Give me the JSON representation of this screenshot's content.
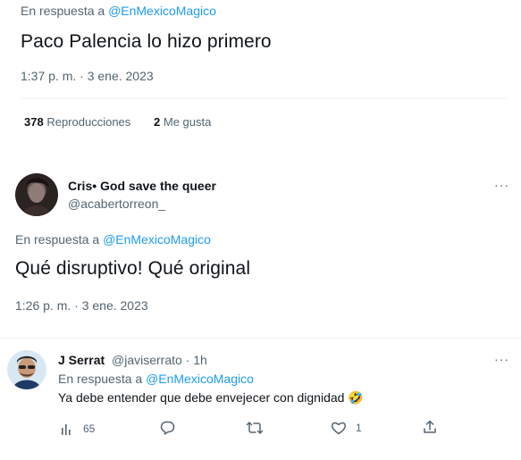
{
  "tweet1": {
    "reply_prefix": "En respuesta a",
    "reply_mention": "@EnMexicoMagico",
    "text": "Paco Palencia lo hizo primero",
    "timestamp": "1:37 p. m. · 3 ene. 2023",
    "views_count": "378",
    "views_label": "Reproducciones",
    "likes_count": "2",
    "likes_label": "Me gusta"
  },
  "tweet2": {
    "author_name": "Cris• God save the queer",
    "author_handle": "@acabertorreon_",
    "more": "···",
    "reply_prefix": "En respuesta a",
    "reply_mention": "@EnMexicoMagico",
    "text": "Qué disruptivo! Qué original",
    "timestamp": "1:26 p. m. · 3 ene. 2023"
  },
  "tweet3": {
    "author_name": "J Serrat",
    "author_meta": "@javiserrato · 1h",
    "more": "···",
    "reply_prefix": "En respuesta a",
    "reply_mention": "@EnMexicoMagico",
    "text": "Ya debe entender que debe envejecer con dignidad 🤣",
    "views_count": "65",
    "likes_count": "1"
  },
  "icons": {
    "views": "bar-chart-icon",
    "reply": "speech-bubble-icon",
    "retweet": "retweet-icon",
    "like": "heart-icon",
    "share": "share-icon",
    "more": "ellipsis-icon"
  },
  "colors": {
    "mention": "#1d9bf0",
    "secondary_text": "#536471",
    "primary_text": "#0f1419",
    "divider": "#eff3f4"
  }
}
